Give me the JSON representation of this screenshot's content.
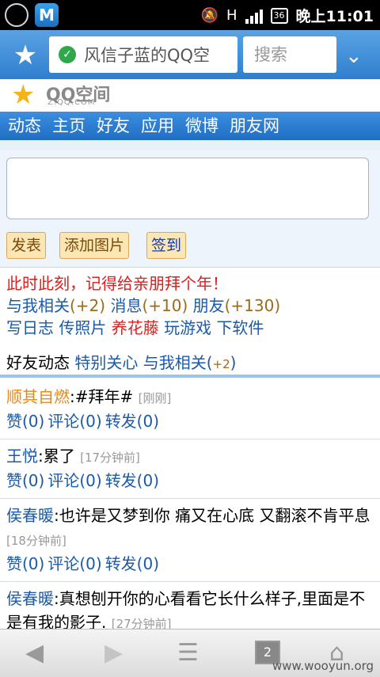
{
  "status_bar": {
    "signal_label": "H",
    "battery": "36",
    "time": "晚上11:01"
  },
  "toolbar": {
    "url": "风信子蓝的QQ空",
    "search_placeholder": "搜索"
  },
  "logo": {
    "text": "QQ空间",
    "sub": "Z.QQ.COM"
  },
  "nav": [
    {
      "label": "动态"
    },
    {
      "label": "主页"
    },
    {
      "label": "好友"
    },
    {
      "label": "应用"
    },
    {
      "label": "微博"
    },
    {
      "label": "朋友网"
    }
  ],
  "buttons": {
    "publish": "发表",
    "add_image": "添加图片",
    "sign_in": "签到"
  },
  "notice": "此时此刻，记得给亲朋拜个年！",
  "links1": {
    "related": "与我相关",
    "related_count": "(+2)",
    "messages": "消息",
    "messages_count": "(+10)",
    "friends": "朋友",
    "friends_count": "(+130)"
  },
  "links2": {
    "diary": "写日志",
    "photo": "传照片",
    "flower": "养花藤",
    "game": "玩游戏",
    "download": "下软件"
  },
  "feed_head": {
    "title": "好友动态",
    "special": "特别关心",
    "related": "与我相关(",
    "count": "+2",
    ")": ")"
  },
  "feed_items": [
    {
      "name": "顺其自燃",
      "text": ":#拜年#",
      "time": "[刚刚]",
      "likes": "赞(0)",
      "comments": "评论(0)",
      "forward": "转发(0)"
    },
    {
      "name": "王悦",
      "text": ":累了",
      "time": "[17分钟前]",
      "likes": "赞(0)",
      "comments": "评论(0)",
      "forward": "转发(0)"
    },
    {
      "name": "侯春暖",
      "text": ":也许是又梦到你 痛又在心底 又翻滚不肯平息",
      "time": "[18分钟前]",
      "likes": "赞(0)",
      "comments": "评论(0)",
      "forward": "转发(0)"
    },
    {
      "name": "侯春暖",
      "text": ":真想刨开你的心看看它长什么样子,里面是不是有我的影子.",
      "time": "[27分钟前]"
    }
  ],
  "bottom": {
    "tabs_count": "2",
    "watermark": "www.wooyun.org"
  }
}
